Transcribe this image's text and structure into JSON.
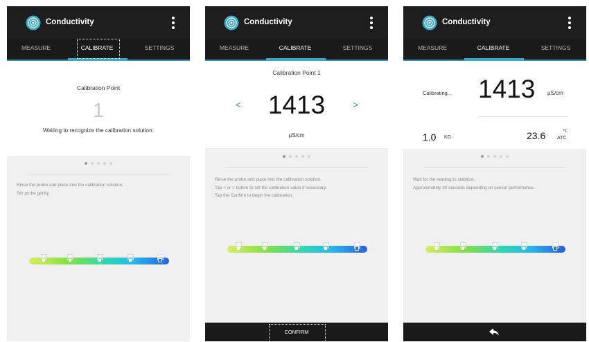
{
  "app": {
    "title": "Conductivity"
  },
  "tabs": [
    "MEASURE",
    "CALIBRATE",
    "SETTINGS"
  ],
  "screen1": {
    "heading": "Calibration Point",
    "number": "1",
    "message": "Waiting to recognize the calibration solution.",
    "instructions": [
      "Rinse the probe and place into the calibration solution.",
      "Stir probe gently."
    ]
  },
  "screen2": {
    "heading": "Calibration Point 1",
    "prev": "<",
    "next": ">",
    "value": "1413",
    "unit": "µS/cm",
    "instructions": [
      "Rinse the probe and place into the calibration solution.",
      "Tap < or > button to set the calibration value if necessary.",
      "Tap the Confirm to begin the calibration."
    ],
    "confirm_label": "CONFIRM"
  },
  "screen3": {
    "status": "Calibrating...",
    "value": "1413",
    "unit": "µS/cm",
    "resistance": "1.0",
    "resistance_unit": "KΩ",
    "temperature": "23.6",
    "temp_unit": "℃",
    "temp_mode": "ATC",
    "instructions": [
      "Wait for the reading to stabilize.",
      "Approximately 30 seconds depending on sensor performance."
    ]
  },
  "pager": {
    "count": 5,
    "active": 1
  },
  "colors": {
    "appbar": "#1e1e1e",
    "accent": "#3aa9c8",
    "arrow": "#3a8fd9",
    "active_marker": "#3a6be8"
  },
  "icons": {
    "logo": "conductivity-logo-icon",
    "menu": "more-vert-icon",
    "back": "back-arrow-icon",
    "prev": "chevron-left-icon",
    "next": "chevron-right-icon"
  }
}
